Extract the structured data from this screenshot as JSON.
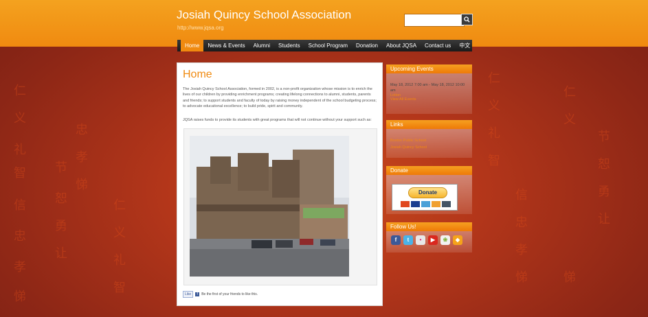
{
  "header": {
    "title": "Josiah Quincy School Association",
    "url": "http://www.jqsa.org",
    "search_button": "🔍"
  },
  "nav": {
    "items": [
      {
        "label": "Home",
        "active": true
      },
      {
        "label": "News & Events"
      },
      {
        "label": "Alumni"
      },
      {
        "label": "Students"
      },
      {
        "label": "School Program"
      },
      {
        "label": "Donation"
      },
      {
        "label": "About JQSA"
      },
      {
        "label": "Contact us"
      },
      {
        "label": "中文"
      }
    ]
  },
  "main": {
    "title": "Home",
    "para1": "The Josiah Quincy School Association, formed in 2002, is a non-profit organization whose mission is to enrich the lives of our children by providing enrichment programs; creating lifelong connections to alumni, students, parents and friends; to support students and faculty of today by raising money independent of the school budgeting process; to advocate educational excellence; to build pride, spirit and community.",
    "para2": "JQSA raises funds to provide its students with great programs that will not continue without your support such as:",
    "like_button": "Like",
    "like_text": "Be the first of your friends to like this."
  },
  "sidebar": {
    "events": {
      "title": "Upcoming Events",
      "event_time": "May 18, 2012 7:00 am - May 18, 2012 10:00 am",
      "event_name": "Lotion",
      "view_all": "View All Events"
    },
    "links": {
      "title": "Links",
      "link1": "Boston Public School",
      "link2": "Josiah Quincy School"
    },
    "donate": {
      "title": "Donate",
      "button": "Donate"
    },
    "follow": {
      "title": "Follow Us!"
    }
  },
  "colors": {
    "accent": "#f08a10",
    "nav_bg": "#1a1a1a",
    "background": "#8e2716"
  },
  "icons": [
    "search-icon",
    "facebook-icon",
    "twitter-icon",
    "flickr-icon",
    "youtube-icon",
    "picasa-icon",
    "rss-icon"
  ]
}
